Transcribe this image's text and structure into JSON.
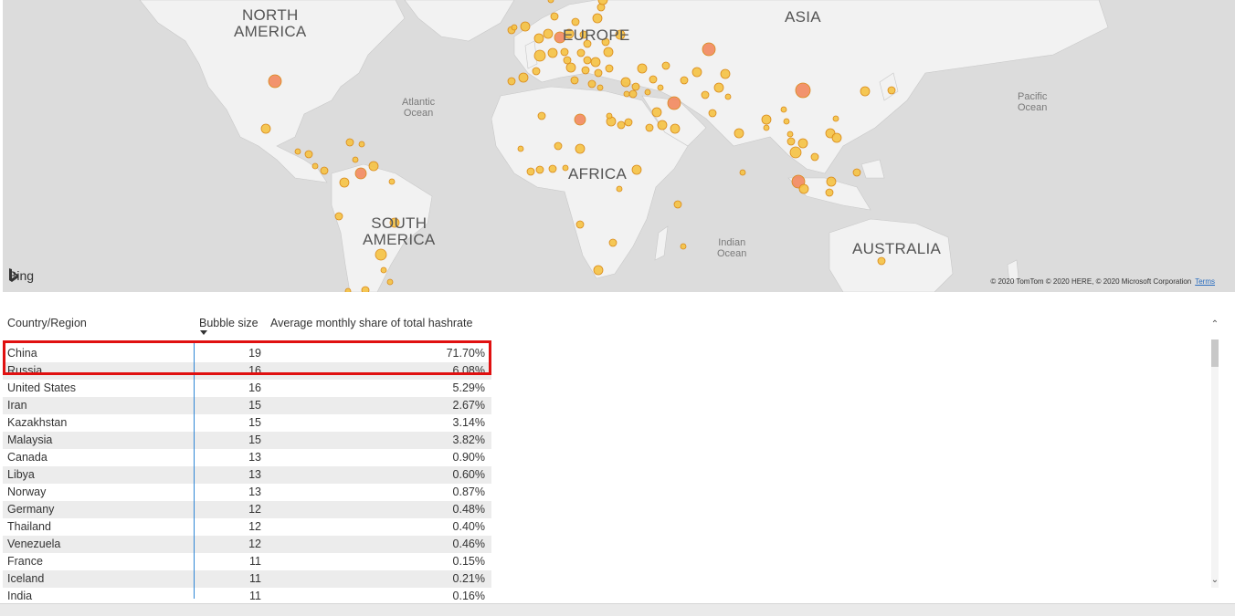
{
  "map": {
    "continents": {
      "north_america_1": "NORTH",
      "north_america_2": "AMERICA",
      "europe": "EUROPE",
      "asia": "ASIA",
      "africa": "AFRICA",
      "south_america_1": "SOUTH",
      "south_america_2": "AMERICA",
      "australia": "AUSTRALIA"
    },
    "oceans": {
      "atlantic_1": "Atlantic",
      "atlantic_2": "Ocean",
      "pacific_1": "Pacific",
      "pacific_2": "Ocean",
      "indian_1": "Indian",
      "indian_2": "Ocean"
    },
    "provider": "Bing",
    "copyright": "© 2020 TomTom © 2020 HERE, © 2020 Microsoft Corporation",
    "terms_link": "Terms",
    "colors": {
      "land": "#f2f2f2",
      "water": "#dcdcdc",
      "bubble_small": "#f5c242",
      "bubble_large": "#f2885e",
      "bubble_stroke": "#d98a1a"
    }
  },
  "table": {
    "headers": {
      "country": "Country/Region",
      "bubble_size": "Bubble size",
      "share": "Average monthly share of total hashrate"
    },
    "sort_column": "Bubble size",
    "rows": [
      {
        "country": "China",
        "bubble_size": "19",
        "share": "71.70%"
      },
      {
        "country": "Russia",
        "bubble_size": "16",
        "share": "6.08%"
      },
      {
        "country": "United States",
        "bubble_size": "16",
        "share": "5.29%"
      },
      {
        "country": "Iran",
        "bubble_size": "15",
        "share": "2.67%"
      },
      {
        "country": "Kazakhstan",
        "bubble_size": "15",
        "share": "3.14%"
      },
      {
        "country": "Malaysia",
        "bubble_size": "15",
        "share": "3.82%"
      },
      {
        "country": "Canada",
        "bubble_size": "13",
        "share": "0.90%"
      },
      {
        "country": "Libya",
        "bubble_size": "13",
        "share": "0.60%"
      },
      {
        "country": "Norway",
        "bubble_size": "13",
        "share": "0.87%"
      },
      {
        "country": "Germany",
        "bubble_size": "12",
        "share": "0.48%"
      },
      {
        "country": "Thailand",
        "bubble_size": "12",
        "share": "0.40%"
      },
      {
        "country": "Venezuela",
        "bubble_size": "12",
        "share": "0.46%"
      },
      {
        "country": "France",
        "bubble_size": "11",
        "share": "0.15%"
      },
      {
        "country": "Iceland",
        "bubble_size": "11",
        "share": "0.21%"
      },
      {
        "country": "India",
        "bubble_size": "11",
        "share": "0.16%"
      }
    ],
    "highlight_color": "#e01010",
    "accent_color": "#2e86d6"
  },
  "scrollbar": {
    "up_icon": "chevron-up-icon",
    "down_icon": "chevron-down-icon"
  }
}
